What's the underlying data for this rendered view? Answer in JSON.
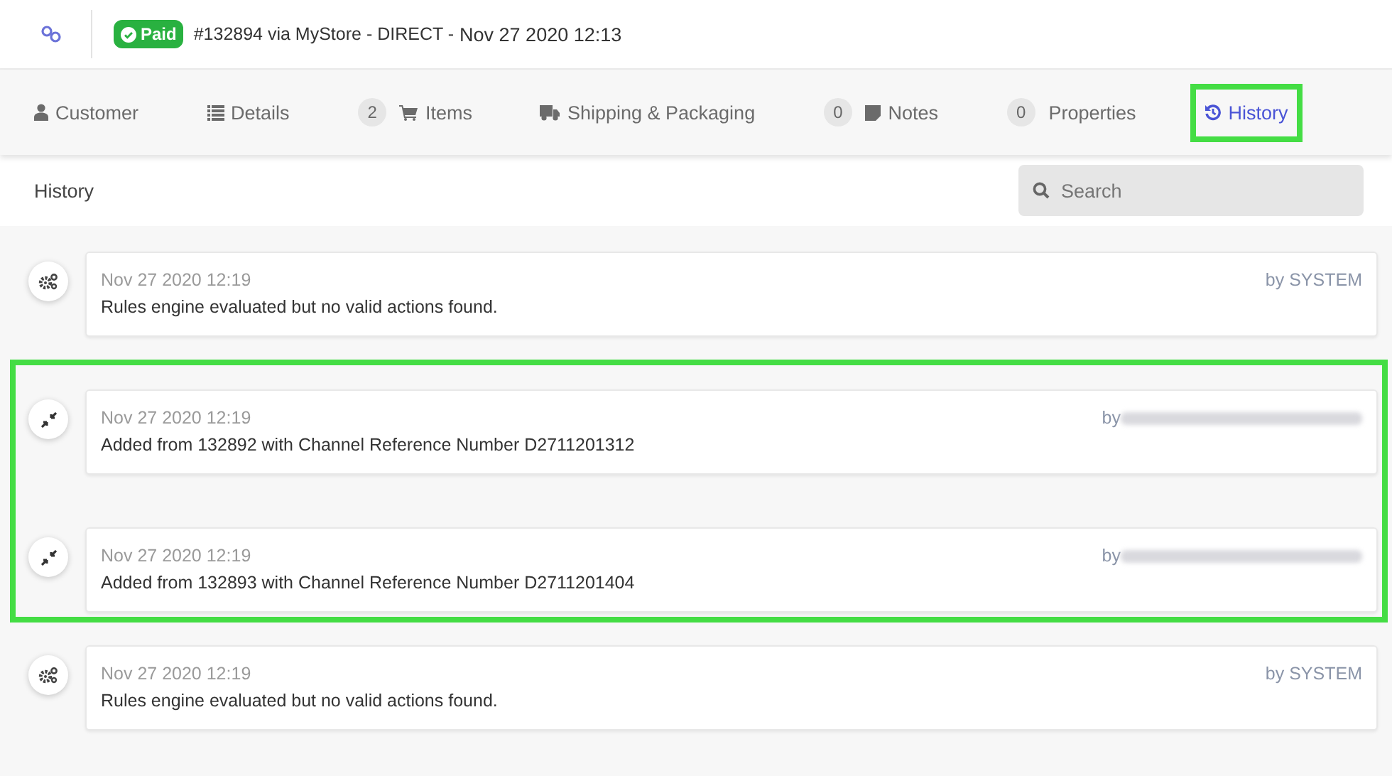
{
  "header": {
    "status_badge": "Paid",
    "order": "#132894 via MyStore - DIRECT -",
    "date": "Nov 27 2020 12:13"
  },
  "tabs": [
    {
      "kind": "customer",
      "label": "Customer",
      "selected": false,
      "highlighted": false
    },
    {
      "kind": "details",
      "label": "Details",
      "selected": false,
      "highlighted": false
    },
    {
      "kind": "items",
      "count": "2",
      "label": "Items",
      "selected": false,
      "highlighted": false
    },
    {
      "kind": "shipping",
      "label": "Shipping & Packaging",
      "selected": false,
      "highlighted": false
    },
    {
      "kind": "notes",
      "count": "0",
      "label": "Notes",
      "selected": false,
      "highlighted": false
    },
    {
      "kind": "properties",
      "count": "0",
      "label": "Properties",
      "selected": false,
      "highlighted": false
    },
    {
      "kind": "history",
      "label": "History",
      "selected": true,
      "highlighted": true
    }
  ],
  "section": {
    "title": "History",
    "search": {
      "placeholder": "Search"
    }
  },
  "groups": [
    {
      "highlighted": false,
      "entries": [
        {
          "kind": "system",
          "time": "Nov 27 2020 12:19",
          "author": "by SYSTEM",
          "redacted": false,
          "message": "Rules engine evaluated but no valid actions found."
        }
      ]
    },
    {
      "highlighted": true,
      "entries": [
        {
          "kind": "merge",
          "time": "Nov 27 2020 12:19",
          "author": "by",
          "redacted": true,
          "message": "Added from 132892 with Channel Reference Number D2711201312"
        },
        {
          "kind": "merge",
          "time": "Nov 27 2020 12:19",
          "author": "by",
          "redacted": true,
          "message": "Added from 132893 with Channel Reference Number D2711201404"
        }
      ]
    },
    {
      "highlighted": false,
      "entries": [
        {
          "kind": "system",
          "time": "Nov 27 2020 12:19",
          "author": "by SYSTEM",
          "redacted": false,
          "message": "Rules engine evaluated but no valid actions found."
        }
      ]
    }
  ]
}
